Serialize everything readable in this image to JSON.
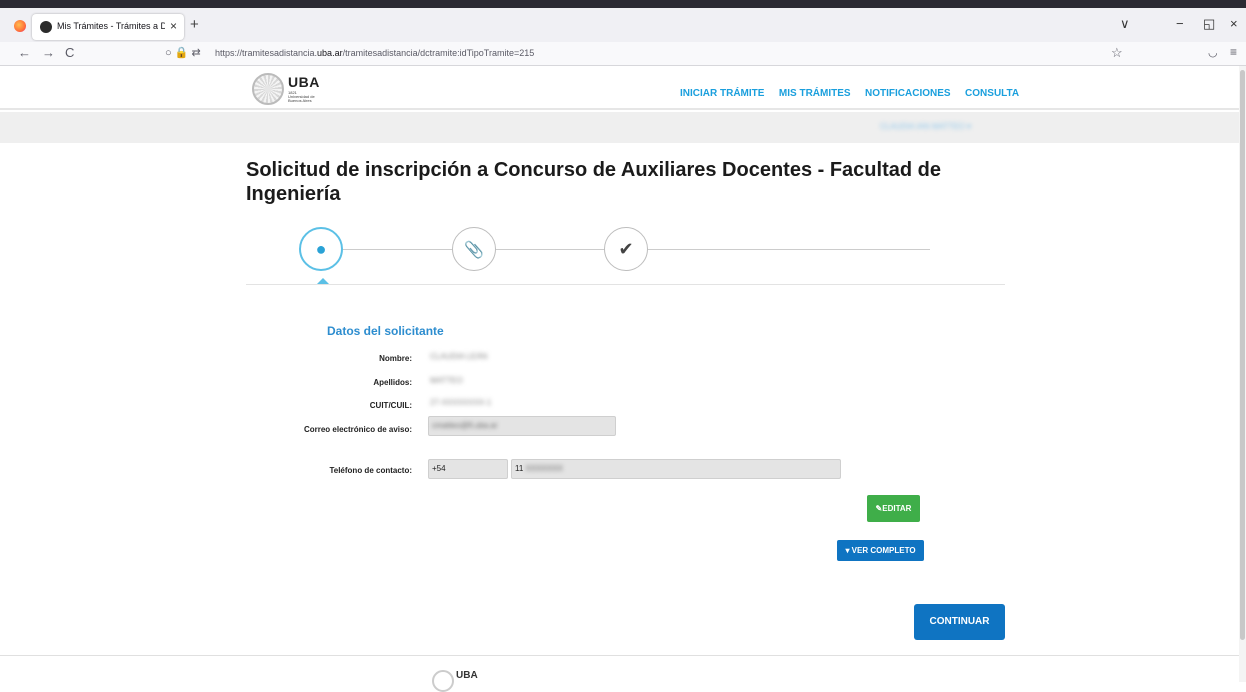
{
  "browser": {
    "tab_title": "Mis Trámites - Trámites a Distan",
    "tab_close": "×",
    "new_tab": "+",
    "back": "←",
    "forward": "→",
    "reload": "C",
    "url_prefix": "https://tramitesadistancia.",
    "url_domain": "uba.ar",
    "url_path": "/tramitesadistancia/dctramite:idTipoTramite=215",
    "bookmark_star": "☆",
    "menu": "≡",
    "minimize": "−",
    "restore": "◱",
    "close": "×",
    "tabs_dropdown": "∨"
  },
  "header": {
    "logo_text": "UBA",
    "logo_subtext": "1821 Universidad de Buenos Aires",
    "nav": [
      {
        "label": "INICIAR TRÁMITE"
      },
      {
        "label": "MIS TRÁMITES"
      },
      {
        "label": "NOTIFICACIONES"
      },
      {
        "label": "CONSULTA"
      }
    ]
  },
  "user_bar": {
    "user_name": "CLAUDIA IAN MATTEO ▾"
  },
  "page": {
    "title": "Solicitud de inscripción a Concurso de Auxiliares Docentes - Facultad de Ingeniería"
  },
  "stepper": {
    "steps": [
      {
        "icon": "user-icon",
        "glyph": "👤",
        "active": true
      },
      {
        "icon": "paperclip-icon",
        "glyph": "📎",
        "active": false
      },
      {
        "icon": "check-icon",
        "glyph": "✔",
        "active": false
      }
    ]
  },
  "form": {
    "section_title": "Datos del solicitante",
    "nombre_label": "Nombre:",
    "nombre_value": "CLAUDIA LEÁN",
    "apellidos_label": "Apellidos:",
    "apellidos_value": "MATTEO",
    "cuit_label": "CUIT/CUIL:",
    "cuit_value": "27-XXXXXXXX-1",
    "correo_label": "Correo electrónico de aviso:",
    "correo_value": "cmatteo@fi.uba.ar",
    "telefono_label": "Teléfono de contacto:",
    "telefono_code": "+54",
    "telefono_area": "11",
    "telefono_number": "XXXXXXX"
  },
  "buttons": {
    "editar": "✎EDITAR",
    "ver_completo": "▾ VER COMPLETO",
    "continuar": "CONTINUAR"
  },
  "footer": {
    "logo_text": "UBA"
  },
  "colors": {
    "accent_blue": "#1a9fdd",
    "button_blue": "#0f74c2",
    "button_green": "#3fae49",
    "section_title": "#2d8dcf"
  }
}
